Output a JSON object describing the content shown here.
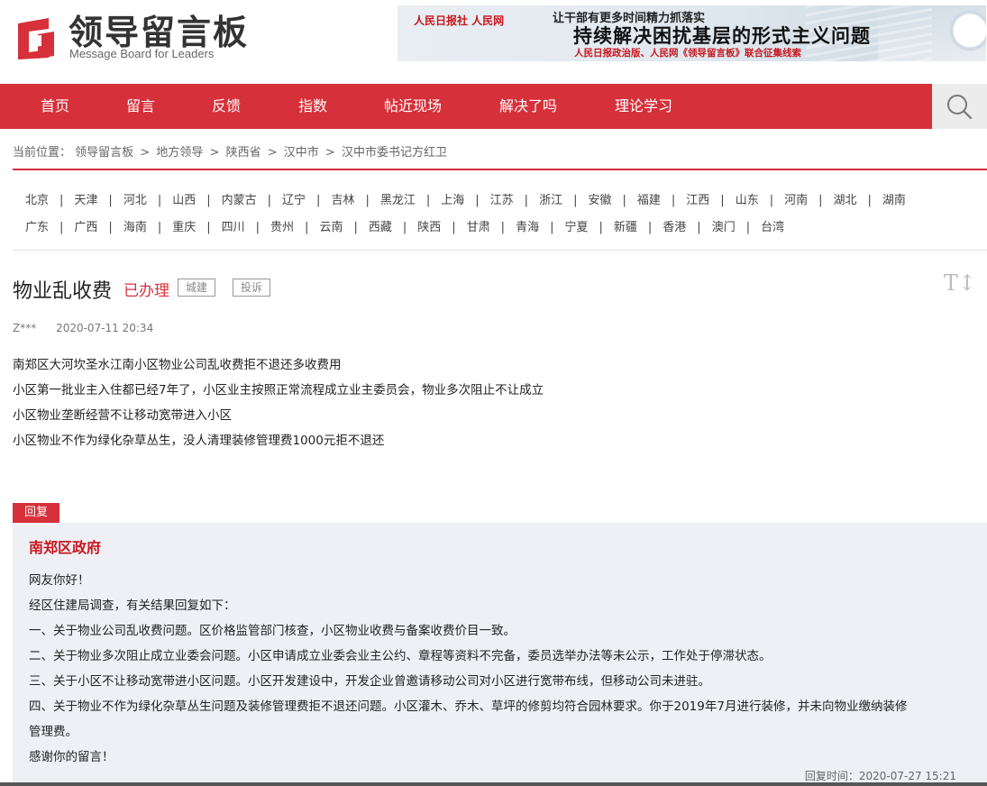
{
  "site": {
    "title_cn": "领导留言板",
    "title_en": "Message Board for Leaders"
  },
  "banner": {
    "logos": "人民日报社  人民网",
    "line1": "让干部有更多时间精力抓落实",
    "line2": "持续解决困扰基层的形式主义问题",
    "line3": "人民日报政治版、人民网《领导留言板》联合征集线索"
  },
  "nav": {
    "items": [
      "首页",
      "留言",
      "反馈",
      "指数",
      "帖近现场",
      "解决了吗",
      "理论学习"
    ],
    "search_icon": "search-icon"
  },
  "breadcrumb": {
    "prefix": "当前位置：",
    "items": [
      "领导留言板",
      "地方领导",
      "陕西省",
      "汉中市",
      "汉中市委书记方红卫"
    ],
    "separator": ">"
  },
  "provinces": {
    "row1": [
      "北京",
      "天津",
      "河北",
      "山西",
      "内蒙古",
      "辽宁",
      "吉林",
      "黑龙江",
      "上海",
      "江苏",
      "浙江",
      "安徽",
      "福建",
      "江西",
      "山东",
      "河南",
      "湖北",
      "湖南"
    ],
    "row2": [
      "广东",
      "广西",
      "海南",
      "重庆",
      "四川",
      "贵州",
      "云南",
      "西藏",
      "陕西",
      "甘肃",
      "青海",
      "宁夏",
      "新疆",
      "香港",
      "澳门",
      "台湾"
    ],
    "separator": "|"
  },
  "post": {
    "title": "物业乱收费",
    "status": "已办理",
    "tags": [
      "城建",
      "投诉"
    ],
    "font_toggle": "T↕",
    "author": "Z***",
    "date": "2020-07-11 20:34",
    "body": [
      "南郑区大河坎圣水江南小区物业公司乱收费拒不退还多收费用",
      "  小区第一批业主入住都已经7年了，小区业主按照正常流程成立业主委员会，物业多次阻止不让成立",
      "    小区物业垄断经营不让移动宽带进入小区",
      "  小区物业不作为绿化杂草丛生，没人清理装修管理费1000元拒不退还"
    ]
  },
  "reply": {
    "tab_label": "回复",
    "org": "南郑区政府",
    "lines": [
      "网友你好！",
      "经区住建局调查，有关结果回复如下：",
      "一、关于物业公司乱收费问题。区价格监管部门核查，小区物业收费与备案收费价目一致。",
      "二、关于物业多次阻止成立业委会问题。小区申请成立业委会业主公约、章程等资料不完备，委员选举办法等未公示，工作处于停滞状态。",
      "三、关于小区不让移动宽带进小区问题。小区开发建设中，开发企业曾邀请移动公司对小区进行宽带布线，但移动公司未进驻。",
      "四、关于物业不作为绿化杂草丛生问题及装修管理费拒不退还问题。小区灌木、乔木、草坪的修剪均符合园林要求。你于2019年7月进行装修，并未向物业缴纳装修",
      "管理费。",
      "感谢你的留言！"
    ],
    "time_label": "回复时间：",
    "time": "2020-07-27 15:21"
  },
  "colors": {
    "brand_red": "#d6303a",
    "reply_bg": "#eef0f5"
  }
}
